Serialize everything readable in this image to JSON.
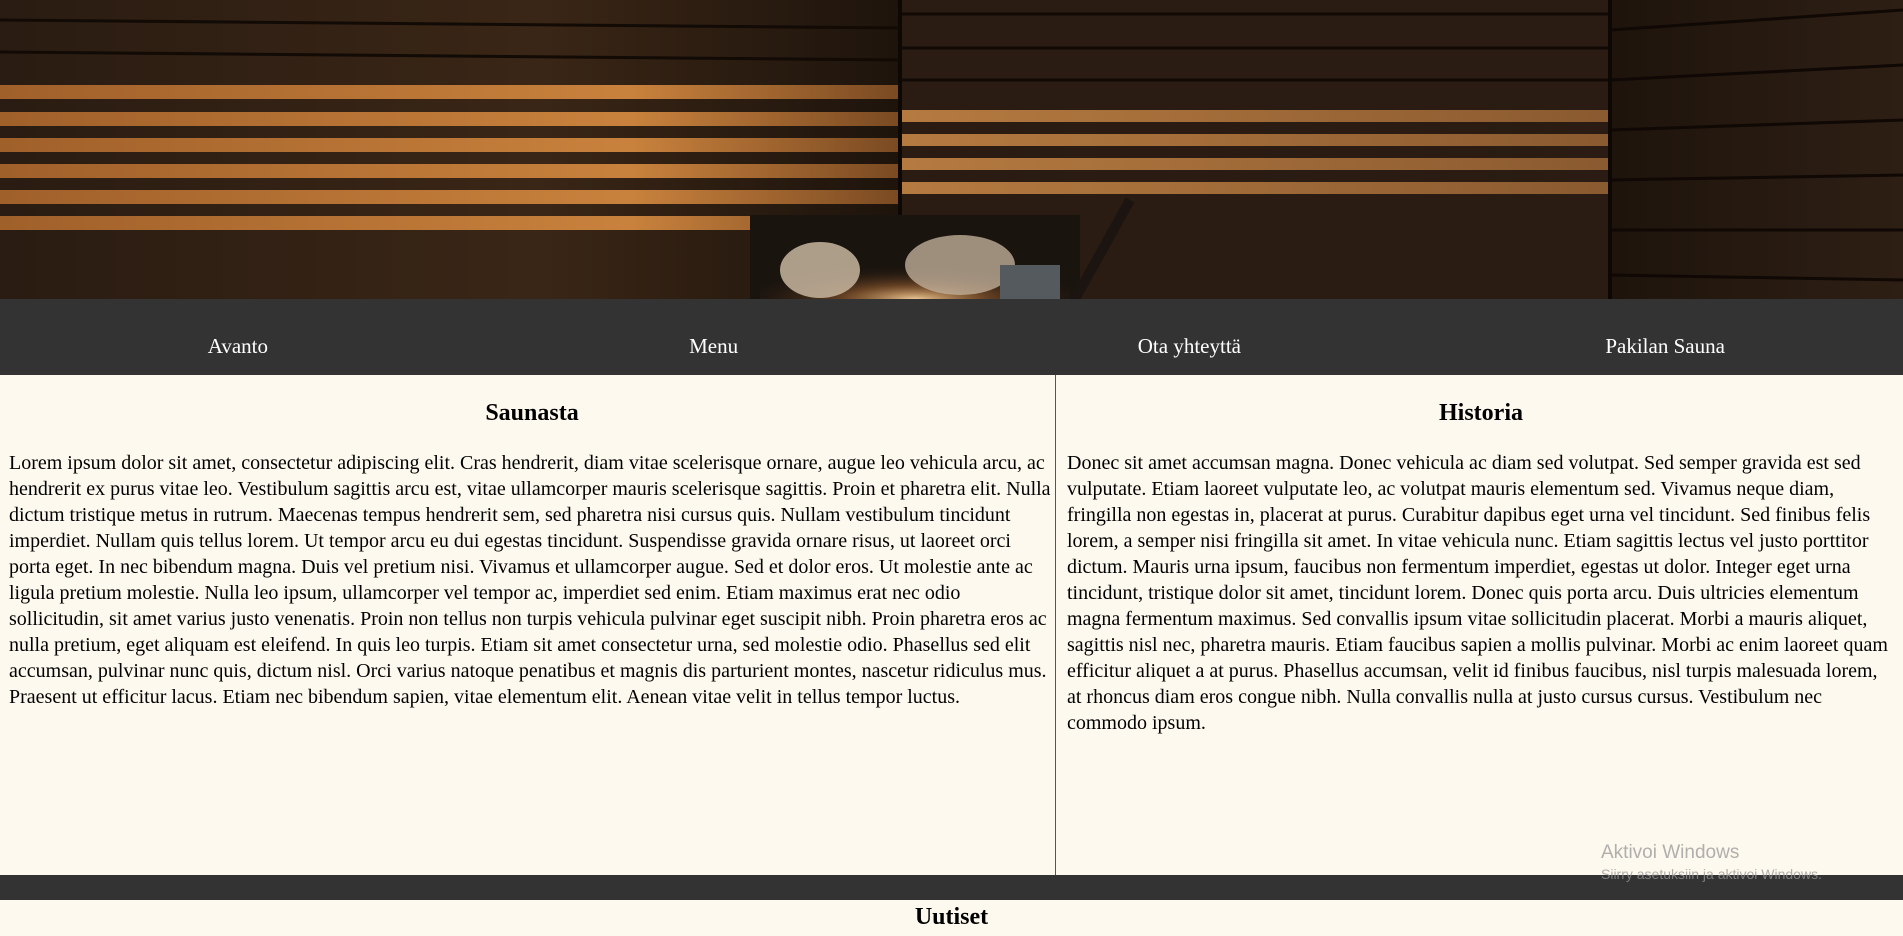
{
  "nav": {
    "items": [
      {
        "label": "Avanto"
      },
      {
        "label": "Menu"
      },
      {
        "label": "Ota yhteyttä"
      },
      {
        "label": "Pakilan Sauna"
      }
    ]
  },
  "sections": {
    "left": {
      "title": "Saunasta",
      "body": "Lorem ipsum dolor sit amet, consectetur adipiscing elit. Cras hendrerit, diam vitae scelerisque ornare, augue leo vehicula arcu, ac hendrerit ex purus vitae leo. Vestibulum sagittis arcu est, vitae ullamcorper mauris scelerisque sagittis. Proin et pharetra elit. Nulla dictum tristique metus in rutrum. Maecenas tempus hendrerit sem, sed pharetra nisi cursus quis. Nullam vestibulum tincidunt imperdiet. Nullam quis tellus lorem. Ut tempor arcu eu dui egestas tincidunt. Suspendisse gravida ornare risus, ut laoreet orci porta eget. In nec bibendum magna. Duis vel pretium nisi. Vivamus et ullamcorper augue. Sed et dolor eros. Ut molestie ante ac ligula pretium molestie. Nulla leo ipsum, ullamcorper vel tempor ac, imperdiet sed enim. Etiam maximus erat nec odio sollicitudin, sit amet varius justo venenatis. Proin non tellus non turpis vehicula pulvinar eget suscipit nibh. Proin pharetra eros ac nulla pretium, eget aliquam est eleifend. In quis leo turpis. Etiam sit amet consectetur urna, sed molestie odio. Phasellus sed elit accumsan, pulvinar nunc quis, dictum nisl. Orci varius natoque penatibus et magnis dis parturient montes, nascetur ridiculus mus. Praesent ut efficitur lacus. Etiam nec bibendum sapien, vitae elementum elit. Aenean vitae velit in tellus tempor luctus."
    },
    "right": {
      "title": "Historia",
      "body": "Donec sit amet accumsan magna. Donec vehicula ac diam sed volutpat. Sed semper gravida est sed vulputate. Etiam laoreet vulputate leo, ac volutpat mauris elementum sed. Vivamus neque diam, fringilla non egestas in, placerat at purus. Curabitur dapibus eget urna vel tincidunt. Sed finibus felis lorem, a semper nisi fringilla sit amet. In vitae vehicula nunc. Etiam sagittis lectus vel justo porttitor dictum. Mauris urna ipsum, faucibus non fermentum imperdiet, egestas ut dolor. Integer eget urna tincidunt, tristique dolor sit amet, tincidunt lorem. Donec quis porta arcu. Duis ultricies elementum magna fermentum maximus. Sed convallis ipsum vitae sollicitudin placerat. Morbi a mauris aliquet, sagittis nisl nec, pharetra mauris. Etiam faucibus sapien a mollis pulvinar. Morbi ac enim laoreet quam efficitur aliquet a at purus. Phasellus accumsan, velit id finibus faucibus, nisl turpis malesuada lorem, at rhoncus diam eros congue nibh. Nulla convallis nulla at justo cursus cursus. Vestibulum nec commodo ipsum."
    }
  },
  "news": {
    "title": "Uutiset"
  },
  "watermark": {
    "title": "Aktivoi Windows",
    "subtitle": "Siirry asetuksiin ja aktivoi Windows."
  },
  "colors": {
    "page_background": "#fdf9ee",
    "nav_background": "#333333",
    "nav_text": "#ffffff"
  },
  "hero_image": {
    "icon": "sauna-interior-image"
  }
}
